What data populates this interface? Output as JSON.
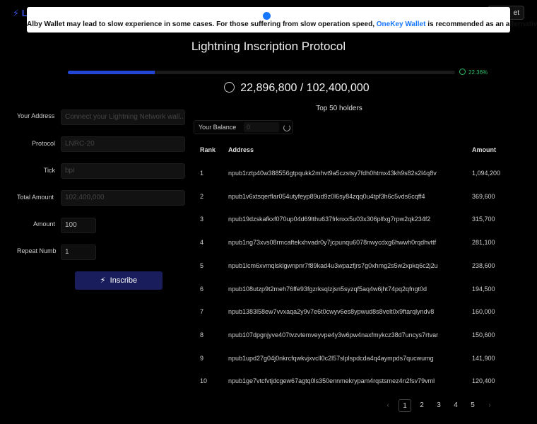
{
  "header": {
    "logo_text": "L",
    "connect_label": "et"
  },
  "banner": {
    "text_before": "Alby Wallet may lead to slow experience in some cases. For those suffering from slow operation speed,",
    "link": "OneKey Wallet",
    "text_after": "is recommended as an alternative"
  },
  "title": "Lightning Inscription Protocol",
  "progress": {
    "percent_value": 22.36,
    "percent_label": "22.36%"
  },
  "supply": {
    "minted": "22,896,800",
    "separator": "/",
    "total": "102,400,000"
  },
  "form": {
    "your_address_label": "Your Address",
    "your_address_placeholder": "Connect your Lightning Network wall...",
    "protocol_label": "Protocol",
    "protocol_value": "LNRC-20",
    "tick_label": "Tick",
    "tick_value": "bpi",
    "total_amount_label": "Total Amount",
    "total_amount_value": "102,400,000",
    "amount_label": "Amount",
    "amount_value": "100",
    "repeat_label": "Repeat Numb",
    "repeat_value": "1",
    "inscribe_label": "Inscribe"
  },
  "holders": {
    "title": "Top 50 holders",
    "balance_label": "Your Balance",
    "balance_value": "0",
    "columns": {
      "rank": "Rank",
      "address": "Address",
      "amount": "Amount"
    },
    "rows": [
      {
        "rank": "1",
        "address": "npub1rztp40w388556gtpqukk2mhvt9a5czstsy7fdh0htmx43kh9s82s2l4q8v",
        "amount": "1,094,200"
      },
      {
        "rank": "2",
        "address": "npub1v6xtsqerflar054utyfeyp89ud9z0l6sy84zqq0u4tpf3h6c5vds6cqff4",
        "amount": "369,600"
      },
      {
        "rank": "3",
        "address": "npub19dzskafkxf070up04d69lthu637frknxx5u03x306plfxg7rpw2qk234f2",
        "amount": "315,700"
      },
      {
        "rank": "4",
        "address": "npub1ng73xvs08rmcaftekxhvadr0y7jcpunqu6078nwycdxg6hwwh0rqdhvttf",
        "amount": "281,100"
      },
      {
        "rank": "5",
        "address": "npub1lcm6xvmqlsklgwnpnr7f89kad4u3wpazfjrs7g0xhmg2s5w2xpkq6c2j2u",
        "amount": "238,600"
      },
      {
        "rank": "6",
        "address": "npub108utzp9t2meh76ffe93fgzrksqlzjsn5syzqf5aq4w6jht74pq2qfngt0d",
        "amount": "194,500"
      },
      {
        "rank": "7",
        "address": "npub1383l58ew7vvxaqa2y9v7e6t0cwyv6es8ypwud8s8velt0x9ftarqlyndv8",
        "amount": "160,000"
      },
      {
        "rank": "8",
        "address": "npub107dpgnjyve407tvzvtemveyvpe4y3w6pw4naxfmykcz38d7uncys7rtvar",
        "amount": "150,600"
      },
      {
        "rank": "9",
        "address": "npub1upd27g04j0nkrcfqwkvjxvcll0c2l57slplspdcda4q4aympds7qucwumg",
        "amount": "141,900"
      },
      {
        "rank": "10",
        "address": "npub1ge7vtcfvtjdcgew67agtq0ls350ennmekrypam4rqstsmez4n2fsv79vml",
        "amount": "120,400"
      }
    ]
  },
  "pagination": {
    "prev": "‹",
    "pages": [
      "1",
      "2",
      "3",
      "4",
      "5"
    ],
    "next": "›",
    "current": "1"
  },
  "colors": {
    "accent": "#2346d8",
    "badge": "#32c06a",
    "link": "#1677ff"
  }
}
